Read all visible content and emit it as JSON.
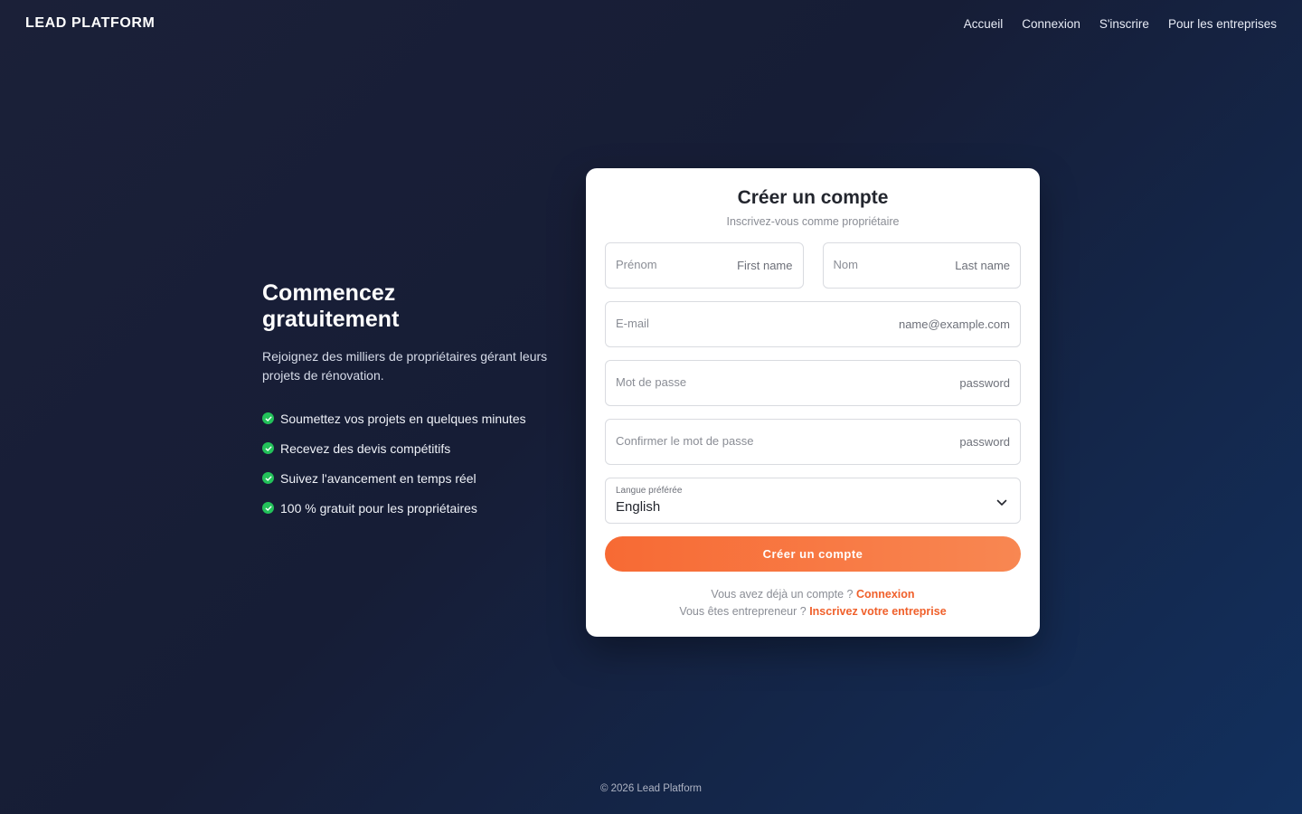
{
  "header": {
    "brand": "LEAD PLATFORM",
    "nav": [
      "Accueil",
      "Connexion",
      "S'inscrire",
      "Pour les entreprises"
    ]
  },
  "hero": {
    "title_line1": "Commencez",
    "title_line2": "gratuitement",
    "description": "Rejoignez des milliers de propriétaires gérant leurs projets de rénovation.",
    "features": [
      "Soumettez vos projets en quelques minutes",
      "Recevez des devis compétitifs",
      "Suivez l'avancement en temps réel",
      "100 % gratuit pour les propriétaires"
    ],
    "check_color": "#23c25a"
  },
  "form": {
    "title": "Créer un compte",
    "subtitle": "Inscrivez-vous comme propriétaire",
    "first_name": {
      "label": "Prénom",
      "placeholder": "First name"
    },
    "last_name": {
      "label": "Nom",
      "placeholder": "Last name"
    },
    "email": {
      "label": "E-mail",
      "placeholder": "name@example.com"
    },
    "password": {
      "label": "Mot de passe",
      "placeholder": "password"
    },
    "confirm_password": {
      "label": "Confirmer le mot de passe",
      "placeholder": "password"
    },
    "language": {
      "label": "Langue préférée",
      "value": "English"
    },
    "submit_label": "Créer un compte",
    "login_prompt": "Vous avez déjà un compte ?",
    "login_link": "Connexion",
    "business_prompt": "Vous êtes entrepreneur ?",
    "business_link": "Inscrivez votre entreprise",
    "accent_color": "#f76a34"
  },
  "footer": {
    "text": "© 2026 Lead Platform"
  }
}
